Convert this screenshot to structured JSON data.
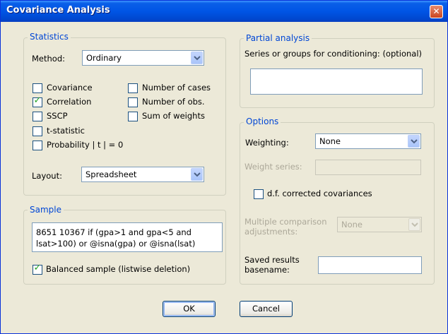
{
  "window": {
    "title": "Covariance Analysis",
    "close_glyph": "✕"
  },
  "statistics": {
    "legend": "Statistics",
    "method_label": "Method:",
    "method_value": "Ordinary",
    "checkboxes": [
      {
        "label": "Covariance",
        "checked": false
      },
      {
        "label": "Correlation",
        "checked": true
      },
      {
        "label": "SSCP",
        "checked": false
      },
      {
        "label": "t-statistic",
        "checked": false
      },
      {
        "label": "Probability | t | = 0",
        "checked": false
      },
      {
        "label": "Number of cases",
        "checked": false
      },
      {
        "label": "Number of obs.",
        "checked": false
      },
      {
        "label": "Sum of weights",
        "checked": false
      }
    ],
    "layout_label": "Layout:",
    "layout_value": "Spreadsheet"
  },
  "sample": {
    "legend": "Sample",
    "text": "8651 10367 if (gpa>1 and gpa<5 and lsat>100) or @isna(gpa) or @isna(lsat)",
    "balanced_label": "Balanced sample (listwise deletion)",
    "balanced_checked": true
  },
  "partial": {
    "legend": "Partial analysis",
    "series_label": "Series or groups for conditioning: (optional)",
    "series_value": ""
  },
  "options": {
    "legend": "Options",
    "weighting_label": "Weighting:",
    "weighting_value": "None",
    "weight_series_label": "Weight series:",
    "df_label": "d.f. corrected covariances",
    "df_checked": false,
    "multiple_label_1": "Multiple comparison",
    "multiple_label_2": "adjustments:",
    "multiple_value": "None",
    "saved_label_1": "Saved results",
    "saved_label_2": "basename:",
    "saved_value": ""
  },
  "buttons": {
    "ok": "OK",
    "cancel": "Cancel"
  },
  "colors": {
    "titlebar": "#0055e5",
    "legend_text": "#0046d5",
    "dialog_bg": "#ece9d8",
    "check": "#21a121"
  }
}
